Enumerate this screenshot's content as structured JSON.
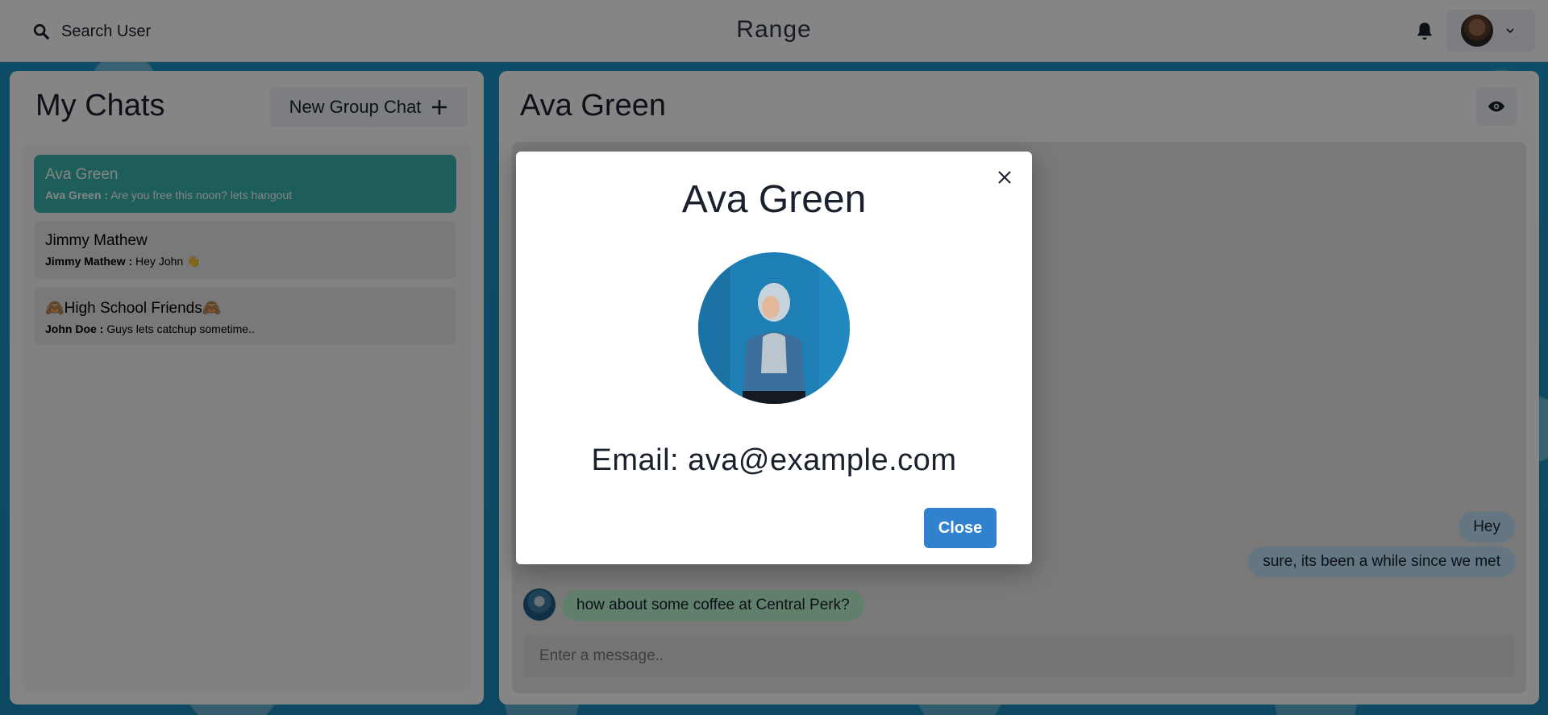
{
  "topbar": {
    "search_label": "Search User",
    "app_title": "Range"
  },
  "sidebar": {
    "title": "My Chats",
    "new_group_label": "New Group Chat",
    "chats": [
      {
        "name": "Ava Green",
        "sender": "Ava Green :",
        "preview": "Are you free this noon? lets hangout",
        "active": true
      },
      {
        "name": "Jimmy Mathew",
        "sender": "Jimmy Mathew :",
        "preview": "Hey John 👋",
        "active": false
      },
      {
        "name": "🙈High School Friends🙈",
        "sender": "John Doe :",
        "preview": "Guys lets catchup sometime..",
        "active": false
      }
    ]
  },
  "conversation": {
    "title": "Ava Green",
    "messages": [
      {
        "text": "Hey",
        "type": "sent"
      },
      {
        "text": "sure, its been a while since we met",
        "type": "sent"
      },
      {
        "text": "how about some coffee at Central Perk?",
        "type": "received"
      }
    ],
    "input_placeholder": "Enter a message.."
  },
  "modal": {
    "title": "Ava Green",
    "email_text": "Email: ava@example.com",
    "close_label": "Close"
  },
  "colors": {
    "active_chat": "#38b2ac",
    "sent_bubble": "#bee3f8",
    "received_bubble": "#b9f5d0",
    "primary_button": "#3182ce"
  }
}
